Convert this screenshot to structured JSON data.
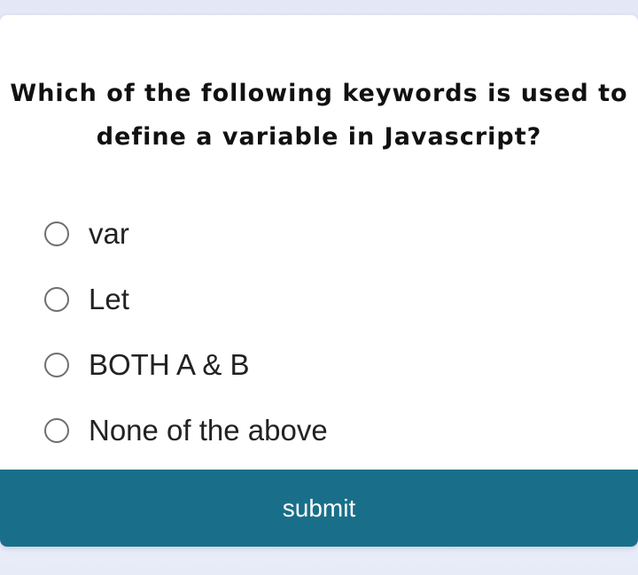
{
  "quiz": {
    "question": "Which of the following keywords is used to define a variable in Javascript?",
    "options": [
      {
        "label": "var",
        "selected": false
      },
      {
        "label": "Let",
        "selected": false
      },
      {
        "label": "BOTH A & B",
        "selected": false
      },
      {
        "label": "None of the above",
        "selected": false
      }
    ],
    "submit_label": "submit"
  },
  "colors": {
    "accent": "#196f89",
    "card_background": "#ffffff",
    "page_background": "#e9edf8"
  }
}
